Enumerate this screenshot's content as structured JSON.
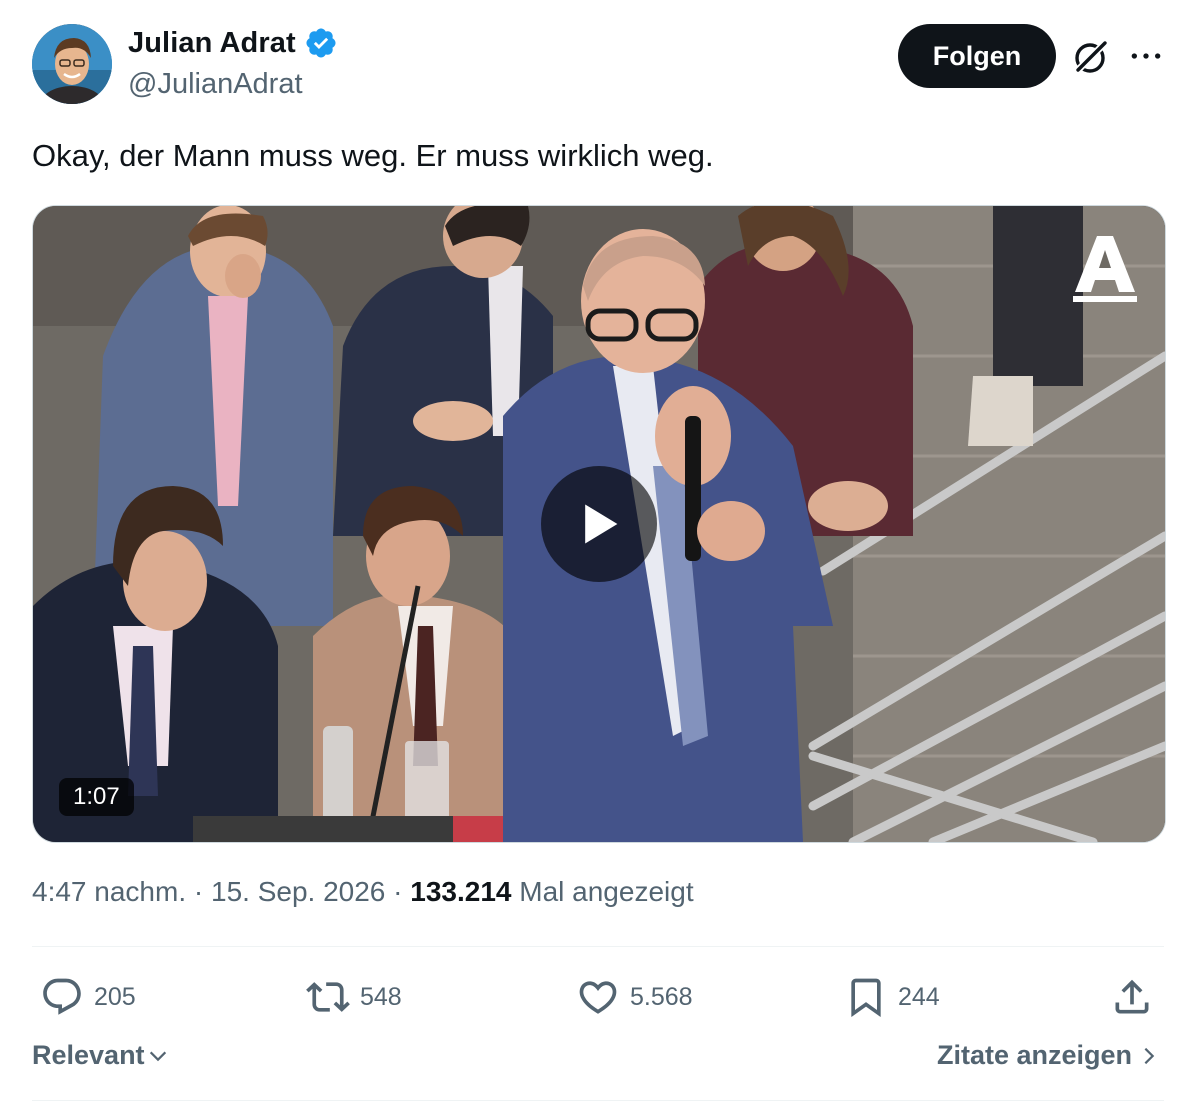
{
  "author": {
    "display_name": "Julian Adrat",
    "handle": "@JulianAdrat",
    "verified": true,
    "follow_label": "Folgen"
  },
  "tweet": {
    "text": "Okay, der Mann muss weg. Er muss wirklich weg.",
    "media": {
      "type": "video",
      "duration": "1:07",
      "channel_logo": "A"
    },
    "time": "4:47 nachm.",
    "separator": "·",
    "date": "15. Sep. 2026",
    "views": "133.214",
    "views_label": "Mal angezeigt"
  },
  "actions": {
    "replies": "205",
    "reposts": "548",
    "likes": "5.568",
    "bookmarks": "244"
  },
  "footer": {
    "sort_label": "Relevant",
    "quotes_label": "Zitate anzeigen"
  },
  "colors": {
    "text_primary": "#0f1419",
    "text_secondary": "#536471",
    "verified_blue": "#1d9bf0",
    "divider": "#eff3f4"
  },
  "icons": {
    "verified": "verified-badge-icon",
    "grok": "grok-icon",
    "more": "more-dots-icon",
    "play": "play-icon",
    "reply": "reply-icon",
    "repost": "repost-icon",
    "like": "heart-icon",
    "bookmark": "bookmark-icon",
    "share": "share-icon",
    "chevron_down": "chevron-down-icon",
    "chevron_right": "chevron-right-icon"
  }
}
